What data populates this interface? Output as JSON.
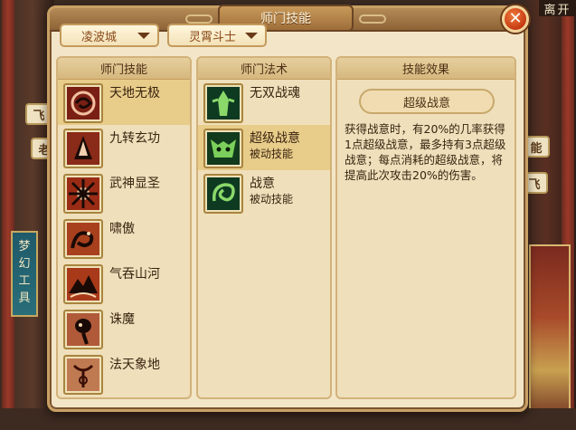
{
  "title": "师门技能",
  "leave_label": "离开",
  "close_symbol": "✕",
  "filters": {
    "city": "凌波城",
    "class": "灵霄斗士"
  },
  "background": {
    "banner_text": [
      "梦",
      "幻",
      "工",
      "具"
    ],
    "signs": [
      "飞",
      "老",
      "能",
      "飞"
    ]
  },
  "columns": {
    "skills_header": "师门技能",
    "magic_header": "师门法术",
    "effect_header": "技能效果"
  },
  "skills": [
    {
      "name": "天地无极",
      "icon": "serpent-icon",
      "selected": true
    },
    {
      "name": "九转玄功",
      "icon": "tower-icon",
      "selected": false
    },
    {
      "name": "武神显圣",
      "icon": "burst-icon",
      "selected": false
    },
    {
      "name": "啸傲",
      "icon": "dragon-icon",
      "selected": false
    },
    {
      "name": "气吞山河",
      "icon": "mountain-icon",
      "selected": false
    },
    {
      "name": "诛魔",
      "icon": "mask-icon",
      "selected": false
    },
    {
      "name": "法天象地",
      "icon": "sigil-icon",
      "selected": false
    }
  ],
  "magic": [
    {
      "name": "无双战魂",
      "sub": "",
      "icon": "warrior-icon",
      "selected": false
    },
    {
      "name": "超级战意",
      "sub": "被动技能",
      "icon": "demon-face-icon",
      "selected": true
    },
    {
      "name": "战意",
      "sub": "被动技能",
      "icon": "swirl-icon",
      "selected": false
    }
  ],
  "effect": {
    "name": "超级战意",
    "description": "获得战意时，有20%的几率获得1点超级战意，最多持有3点超级战意；每点消耗的超级战意，将提高此次攻击20%的伤害。"
  },
  "colors": {
    "panel_bg": "#f3e6c8",
    "title_bar": "#8e6437",
    "selected_row": "#e8cc8a",
    "close_button": "#c63a14",
    "dropdown_text": "#8a4a1a"
  }
}
